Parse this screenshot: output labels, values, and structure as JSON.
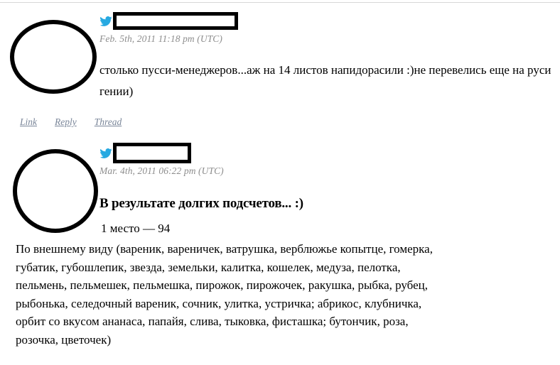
{
  "page": {
    "background_color": "#ffffff",
    "text_color": "#000000",
    "link_color": "#7a8699",
    "timestamp_color": "#8d8d8d",
    "twitter_icon_color": "#27a9e1"
  },
  "comments": [
    {
      "avatar": "avatar-placeholder-circle",
      "icon": "twitter-bird-icon",
      "username": "",
      "username_redacted": true,
      "timestamp": "Feb. 5th, 2011 11:18 pm (UTC)",
      "body": "столько пусси-менеджеров...аж на 14 листов напидорасили :)не перевелись еще на руси гении)",
      "actions": [
        {
          "label": "Link"
        },
        {
          "label": "Reply"
        },
        {
          "label": "Thread"
        }
      ]
    },
    {
      "avatar": "avatar-placeholder-circle",
      "icon": "twitter-bird-icon",
      "username": "",
      "username_redacted": true,
      "timestamp": "Mar. 4th, 2011 06:22 pm (UTC)",
      "title": "В результате долгих подсчетов... :)",
      "place_line": "1 место — 94",
      "listing_lines": [
        "По внешнему виду (вареник, вареничек, ватрушка, верблюжье копытце, гомерка,",
        "губатик, губошлепик, звезда, земельки, калитка, кошелек, медуза, пелотка,",
        "пельмень, пельмешек, пельмешка, пирожок, пирожочек, ракушка, рыбка, рубец,",
        "рыбонька, селедочный вареник, сочник, улитка, устричка; абрикос, клубничка,",
        "орбит со вкусом ананаса, папайя, слива, тыковка, фисташка; бутончик, роза,",
        "розочка, цветочек)"
      ]
    }
  ]
}
